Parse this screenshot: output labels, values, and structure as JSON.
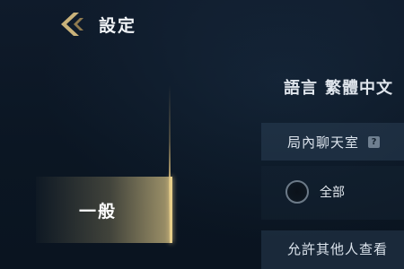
{
  "header": {
    "back_icon": "chevron-left-icon",
    "title": "設定"
  },
  "sidebar": {
    "items": [
      {
        "label": "一般",
        "active": true
      }
    ]
  },
  "main": {
    "language": {
      "label": "語言",
      "value": "繁體中文"
    },
    "in_game_chat": {
      "label": "局內聊天室",
      "help_icon": "?",
      "options": [
        {
          "label": "全部",
          "selected": false
        }
      ]
    },
    "allow_others": {
      "label": "允許其他人查看"
    }
  },
  "colors": {
    "accent_gold": "#e8cf8a",
    "background": "#0f1b2b",
    "panel": "#2a3e54"
  }
}
